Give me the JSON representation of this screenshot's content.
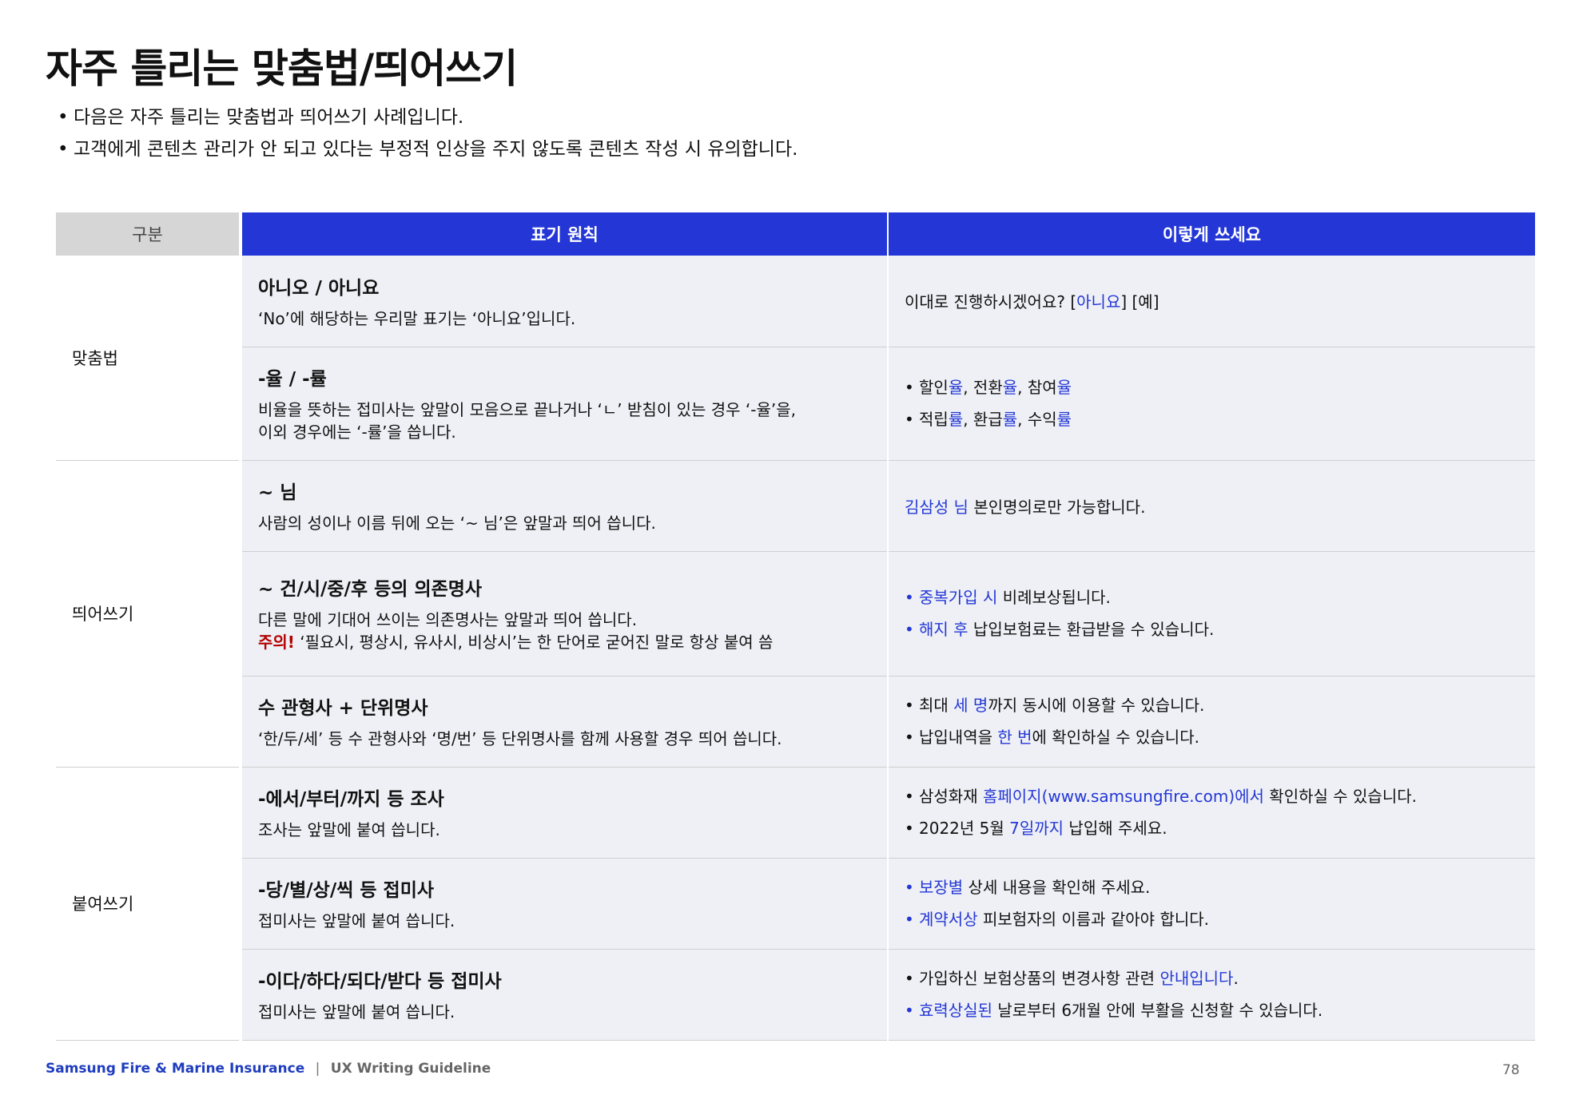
{
  "title": "자주 틀리는 맞춤법/띄어쓰기",
  "intro": [
    "다음은 자주 틀리는 맞춤법과 띄어쓰기 사례입니다.",
    "고객에게 콘텐츠 관리가 안 되고 있다는 부정적 인상을 주지 않도록 콘텐츠 작성 시 유의합니다."
  ],
  "table": {
    "headers": {
      "category": "구분",
      "rule": "표기 원칙",
      "example": "이렇게 쓰세요"
    },
    "groups": [
      {
        "category": "맞춤법",
        "rows": [
          {
            "title": "아니오 / 아니요",
            "desc": [
              "‘No’에 해당하는 우리말 표기는 ‘아니요’입니다."
            ],
            "example": {
              "pre": "이대로 진행하시겠어요? [",
              "hl": "아니요",
              "post": "] [예]"
            }
          },
          {
            "title": "-율 / -률",
            "desc": [
              "비율을 뜻하는 접미사는 앞말이 모음으로 끝나거나 ‘ㄴ’ 받침이 있는 경우 ‘-율’을,",
              "이외 경우에는 ‘-률’을 씁니다."
            ],
            "bullets": [
              {
                "a": "할인",
                "b": "율",
                "c": ", 전환",
                "d": "율",
                "e": ", 참여",
                "f": "율"
              },
              {
                "a": "적립",
                "b": "률",
                "c": ", 환급",
                "d": "률",
                "e": ", 수익",
                "f": "률"
              }
            ]
          }
        ]
      },
      {
        "category": "띄어쓰기",
        "rows": [
          {
            "title": "~ 님",
            "desc": [
              "사람의 성이나 이름 뒤에 오는 ‘~ 님’은 앞말과 띄어 씁니다."
            ],
            "example": {
              "hl": "김삼성 님",
              "post": " 본인명의로만 가능합니다."
            }
          },
          {
            "title": "~ 건/시/중/후 등의 의존명사",
            "desc": [
              "다른 말에 기대어 쓰이는 의존명사는 앞말과 띄어 씁니다."
            ],
            "warn_label": "주의!",
            "warn_text": " ‘필요시, 평상시, 유사시, 비상시’는 한 단어로 굳어진 말로 항상 붙여 씀",
            "bullets": [
              {
                "hl": "중복가입 시",
                "post": " 비례보상됩니다."
              },
              {
                "hl": "해지 후",
                "post": " 납입보험료는 환급받을 수 있습니다."
              }
            ]
          },
          {
            "title": "수 관형사 + 단위명사",
            "desc": [
              "‘한/두/세’ 등 수 관형사와 ‘명/번’ 등 단위명사를 함께 사용할 경우 띄어 씁니다."
            ],
            "bullets": [
              {
                "pre": "최대 ",
                "hl": "세 명",
                "post": "까지 동시에 이용할 수 있습니다."
              },
              {
                "pre": "납입내역을 ",
                "hl": "한 번",
                "post": "에 확인하실 수 있습니다."
              }
            ]
          }
        ]
      },
      {
        "category": "붙여쓰기",
        "rows": [
          {
            "title": "-에서/부터/까지 등 조사",
            "desc": [
              "조사는 앞말에 붙여 씁니다."
            ],
            "bullets": [
              {
                "pre": "삼성화재 ",
                "hl": "홈페이지(www.samsungfire.com)에서",
                "post": " 확인하실 수 있습니다."
              },
              {
                "pre": "2022년 5월 ",
                "hl": "7일까지",
                "post": " 납입해 주세요."
              }
            ]
          },
          {
            "title": "-당/별/상/씩 등 접미사",
            "desc": [
              "접미사는 앞말에 붙여 씁니다."
            ],
            "bullets": [
              {
                "hl": "보장별",
                "post": " 상세 내용을 확인해 주세요."
              },
              {
                "hl": "계약서상",
                "post": " 피보험자의 이름과 같아야 합니다."
              }
            ]
          },
          {
            "title": "-이다/하다/되다/받다 등 접미사",
            "desc": [
              "접미사는 앞말에 붙여 씁니다."
            ],
            "bullets": [
              {
                "pre": "가입하신 보험상품의 변경사항 관련 ",
                "hl": "안내입니다",
                "post": "."
              },
              {
                "hl": "효력상실된",
                "post": " 날로부터 6개월 안에 부활을 신청할 수 있습니다."
              }
            ]
          }
        ]
      }
    ]
  },
  "footer": {
    "brand": "Samsung Fire & Marine Insurance",
    "sep": "|",
    "guide": "UX Writing Guideline",
    "page": "78"
  },
  "colors": {
    "accent": "#2437d6",
    "warning": "#b30000",
    "row_bg": "#eef0f5",
    "header_gray": "#d6d6d6"
  }
}
